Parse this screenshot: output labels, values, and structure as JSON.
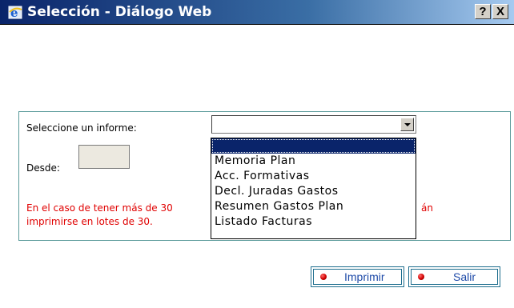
{
  "window": {
    "title": "Selección - Diálogo Web",
    "help_label": "?",
    "close_label": "X"
  },
  "form": {
    "report_label": "Seleccione un informe:",
    "from_label": "Desde:",
    "from_value": "",
    "selected_report": ""
  },
  "warning": {
    "line1_visible_start": "En el caso de tener más de 30",
    "line1_visible_end": "án",
    "line2": "imprimirse en lotes de 30."
  },
  "dropdown": {
    "options": [
      "",
      "Memoria Plan",
      "Acc. Formativas",
      "Decl. Juradas Gastos",
      "Resumen Gastos Plan",
      "Listado Facturas"
    ],
    "highlighted_index": 0
  },
  "buttons": {
    "print_label": "Imprimir",
    "exit_label": "Salir"
  },
  "colors": {
    "warning_text": "#e00000",
    "button_text": "#1e4aa8",
    "panel_border": "#5a9a9a",
    "selection_bg": "#0a246a"
  }
}
